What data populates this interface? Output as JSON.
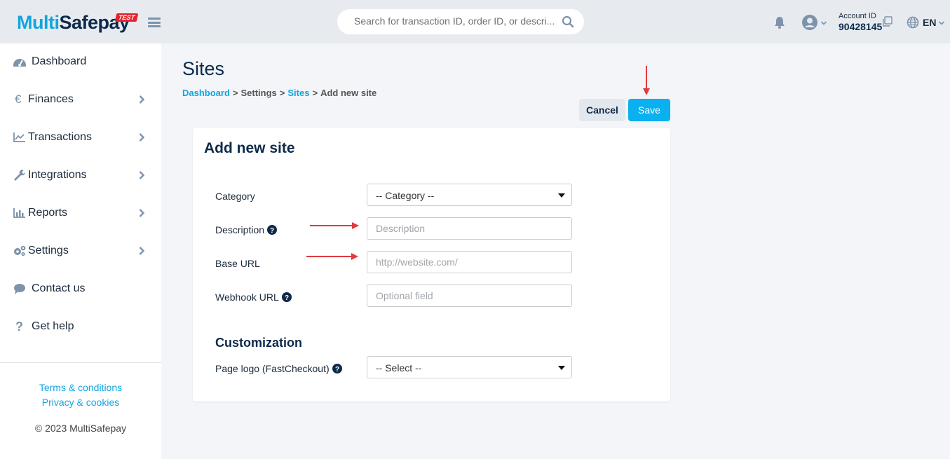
{
  "header": {
    "logo_part1": "Multi",
    "logo_part2": "Safepay",
    "test_badge": "TEST",
    "search_placeholder": "Search for transaction ID, order ID, or descri...",
    "account_label": "Account ID",
    "account_id": "90428145",
    "language": "EN"
  },
  "sidebar": {
    "items": [
      {
        "label": "Dashboard",
        "icon": "dashboard-icon"
      },
      {
        "label": "Finances",
        "icon": "euro-icon"
      },
      {
        "label": "Transactions",
        "icon": "chart-line-icon"
      },
      {
        "label": "Integrations",
        "icon": "wrench-icon"
      },
      {
        "label": "Reports",
        "icon": "bar-chart-icon"
      },
      {
        "label": "Settings",
        "icon": "gears-icon"
      },
      {
        "label": "Contact us",
        "icon": "chat-icon"
      },
      {
        "label": "Get help",
        "icon": "question-icon"
      }
    ],
    "terms": "Terms & conditions",
    "privacy": "Privacy & cookies",
    "copyright": "© 2023 MultiSafepay"
  },
  "page": {
    "title": "Sites",
    "breadcrumb": {
      "dashboard": "Dashboard",
      "settings": "Settings",
      "sites": "Sites",
      "current": "Add new site",
      "separator": ">"
    },
    "cancel_label": "Cancel",
    "save_label": "Save"
  },
  "form": {
    "title": "Add new site",
    "category_label": "Category",
    "category_value": "-- Category --",
    "description_label": "Description",
    "description_placeholder": "Description",
    "base_url_label": "Base URL",
    "base_url_placeholder": "http://website.com/",
    "webhook_label": "Webhook URL",
    "webhook_placeholder": "Optional field",
    "customization_title": "Customization",
    "page_logo_label": "Page logo (FastCheckout)",
    "page_logo_value": "-- Select --"
  },
  "colors": {
    "accent": "#12a5df",
    "save_button": "#0ab0ef",
    "annotation_arrow": "#e03a3e",
    "brand_dark": "#0d2a4a"
  }
}
